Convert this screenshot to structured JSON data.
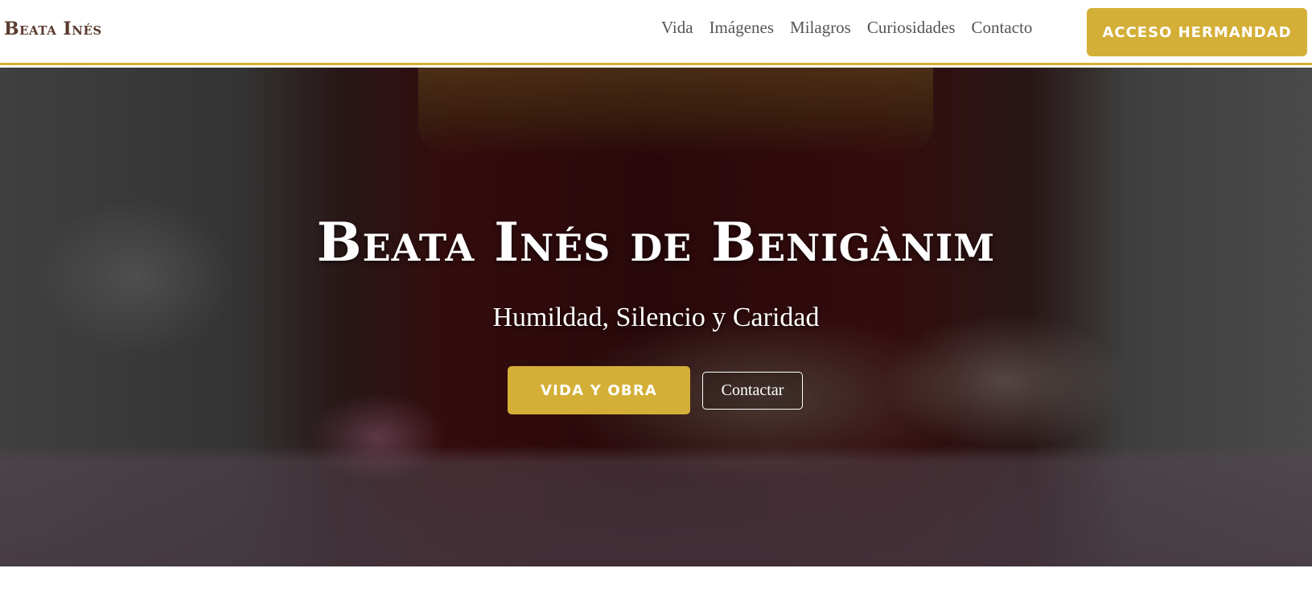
{
  "header": {
    "brand": "Beata Inés",
    "nav": [
      "Vida",
      "Imágenes",
      "Milagros",
      "Curiosidades",
      "Contacto"
    ],
    "cta_label": "ACCESO HERMANDAD"
  },
  "hero": {
    "title": "Beata Inés de Benigànim",
    "subtitle": "Humildad, Silencio y Caridad",
    "primary_button": "VIDA Y OBRA",
    "secondary_button": "Contactar"
  },
  "colors": {
    "accent": "#d4af37",
    "brand_text": "#5a3a2e",
    "nav_text": "#555555"
  }
}
